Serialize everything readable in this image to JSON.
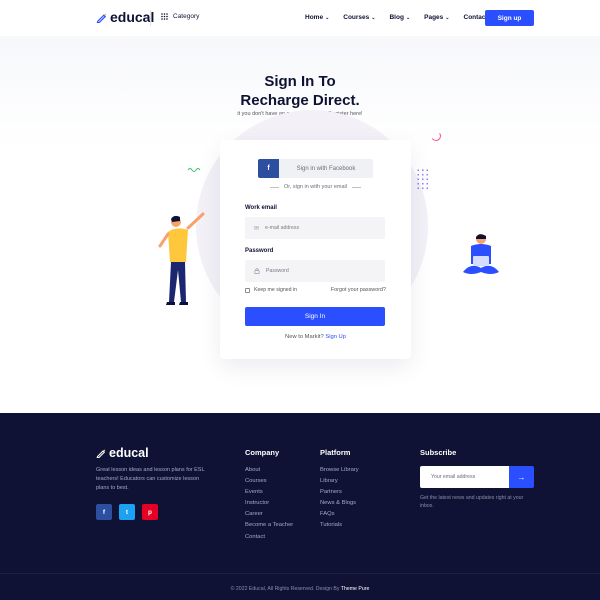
{
  "header": {
    "logo_text": "educal",
    "category_label": "Category",
    "nav": [
      {
        "label": "Home"
      },
      {
        "label": "Courses"
      },
      {
        "label": "Blog"
      },
      {
        "label": "Pages"
      },
      {
        "label": "Contact"
      }
    ],
    "signup_label": "Sign up"
  },
  "hero": {
    "title_line1": "Sign In To",
    "title_line2": "Recharge Direct.",
    "subtitle": "it you don't have an account you can Register here!"
  },
  "form": {
    "facebook_label": "Sign in with Facebook",
    "or_text": "Or, sign in with your email",
    "email_label": "Work email",
    "email_placeholder": "e-mail address",
    "password_label": "Password",
    "password_placeholder": "Password",
    "remember_label": "Keep me signed in",
    "forgot_label": "Forgot your password?",
    "signin_label": "Sign In",
    "new_to_text": "New to Markit?",
    "new_to_link": "Sign Up"
  },
  "footer": {
    "logo_text": "educal",
    "about": "Great lesson ideas and lesson plans for ESL teachers! Educators can customize lesson plans to best.",
    "socials": [
      {
        "icon": "facebook-icon",
        "glyph": "f",
        "color": "#2c4fa0"
      },
      {
        "icon": "twitter-icon",
        "glyph": "t",
        "color": "#1da1f2"
      },
      {
        "icon": "pinterest-icon",
        "glyph": "p",
        "color": "#e60023"
      }
    ],
    "company": {
      "heading": "Company",
      "links": [
        "About",
        "Courses",
        "Events",
        "Instructor",
        "Career",
        "Become a Teacher",
        "Contact"
      ]
    },
    "platform": {
      "heading": "Platform",
      "links": [
        "Browse Library",
        "Library",
        "Partners",
        "News & Blogs",
        "FAQs",
        "Tutorials"
      ]
    },
    "subscribe": {
      "heading": "Subscribe",
      "placeholder": "Your email address",
      "note": "Get the latest news and updates right at your inbox."
    },
    "copyright_prefix": "© 2022 Educal, All Rights Reserved. Design By",
    "copyright_brand": "Theme Pure"
  },
  "colors": {
    "primary": "#2b4eff",
    "footer_bg": "#0f1235",
    "facebook": "#2c4fa0",
    "twitter": "#1da1f2",
    "pinterest": "#e60023"
  }
}
